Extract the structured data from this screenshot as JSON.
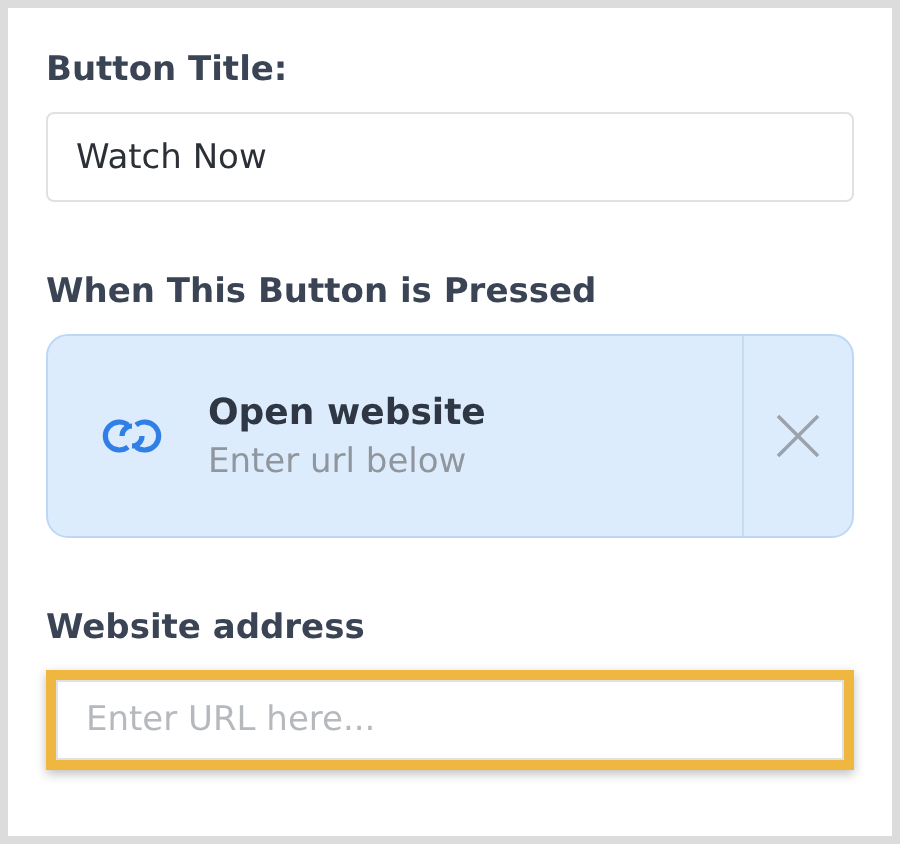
{
  "button_title": {
    "label": "Button Title:",
    "value": "Watch Now"
  },
  "action": {
    "label": "When This Button is Pressed",
    "title": "Open website",
    "subtitle": "Enter url below"
  },
  "website_address": {
    "label": "Website address",
    "placeholder": "Enter URL here...",
    "highlighted": true
  }
}
